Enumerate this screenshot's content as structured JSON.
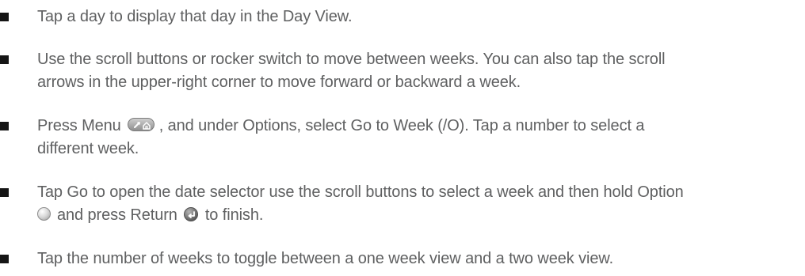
{
  "bullets": [
    {
      "text": "Tap a day to display that day in the Day View."
    },
    {
      "line1": "Use the scroll buttons or rocker switch to move between weeks. You can also tap the scroll",
      "line2": "arrows in the upper-right corner to move forward or backward a week."
    },
    {
      "line1_before": "Press Menu",
      "line1_after": ", and under Options, select Go to Week (/O). Tap a number to select a",
      "line2": "different week.",
      "icon": "menu-key-icon"
    },
    {
      "line1": "Tap Go to open the date selector use the scroll buttons to select a week and then hold Option",
      "line2_between": "and press Return",
      "line2_end": "to finish.",
      "icons": [
        "option-key-icon",
        "return-key-icon"
      ]
    },
    {
      "text": "Tap the number of weeks to toggle between a one week view and a two week view."
    }
  ],
  "colors": {
    "text": "#5f6061",
    "bullet": "#151515"
  }
}
